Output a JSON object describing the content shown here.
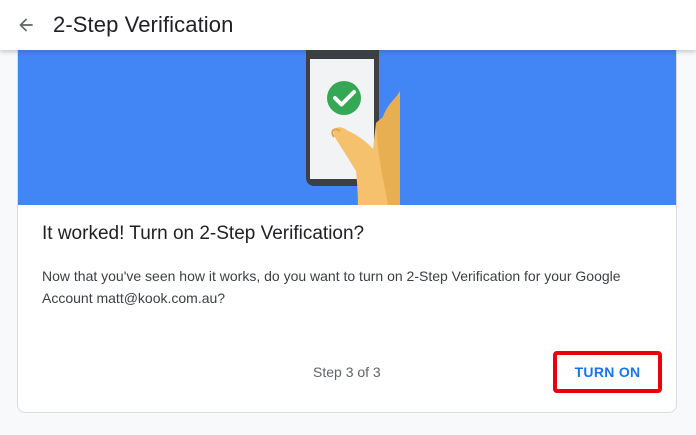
{
  "header": {
    "title": "2-Step Verification",
    "back_icon": "arrow-back-icon"
  },
  "hero": {
    "illustration": "phone-in-hand-with-green-checkmark",
    "background_color": "#4285f4",
    "check_color": "#34a853"
  },
  "card": {
    "heading": "It worked! Turn on 2-Step Verification?",
    "body": "Now that you've seen how it works, do you want to turn on 2-Step Verification for your Google Account matt@kook.com.au?",
    "step_indicator": "Step 3 of 3",
    "turn_on_label": "TURN ON"
  },
  "colors": {
    "accent": "#1a73e8",
    "highlight_border": "#e8000b"
  }
}
